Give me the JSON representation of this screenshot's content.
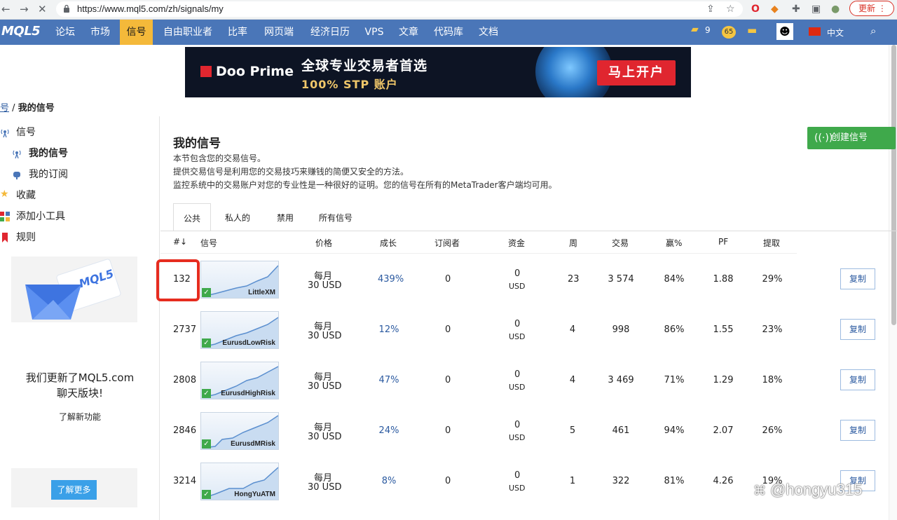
{
  "browser": {
    "url": "https://www.mql5.com/zh/signals/my",
    "update_label": "更新"
  },
  "nav": {
    "logo": "MQL5",
    "items": [
      "论坛",
      "市场",
      "信号",
      "自由职业者",
      "比率",
      "网页端",
      "经济日历",
      "VPS",
      "文章",
      "代码库",
      "文档"
    ],
    "active_index": 2,
    "folder_count": "9",
    "badge_count": "65",
    "language": "中文"
  },
  "banner": {
    "brand": "Doo Prime",
    "headline": "全球专业交易者首选",
    "subline": "100% STP 账户",
    "cta": "马上开户"
  },
  "breadcrumb": {
    "parent": "号",
    "separator": "/",
    "current": "我的信号"
  },
  "sidebar": {
    "items": [
      {
        "label": "信号",
        "icon": "antenna-icon"
      },
      {
        "label": "我的信号",
        "icon": "antenna-icon"
      },
      {
        "label": "我的订阅",
        "icon": "mailbox-icon"
      },
      {
        "label": "收藏",
        "icon": "star-icon"
      },
      {
        "label": "添加小工具",
        "icon": "widgets-icon"
      },
      {
        "label": "规则",
        "icon": "bookmark-icon"
      }
    ],
    "promo_card_logo": "MQL5",
    "promo_text_line1": "我们更新了MQL5.com",
    "promo_text_line2": "聊天版块!",
    "promo_link": "了解新功能",
    "learn_more": "了解更多"
  },
  "main": {
    "title": "我的信号",
    "desc1": "本节包含您的交易信号。",
    "desc2": "提供交易信号是利用您的交易技巧来赚钱的简便又安全的方法。",
    "desc3": "监控系统中的交易账户对您的专业性是一种很好的证明。您的信号在所有的MetaTrader客户端均可用。",
    "create_button": "创建信号",
    "tabs": [
      "公共",
      "私人的",
      "禁用",
      "所有信号"
    ],
    "active_tab": 0
  },
  "table": {
    "headers": {
      "num": "#↓",
      "signal": "信号",
      "price": "价格",
      "growth": "成长",
      "subscribers": "订阅者",
      "funds": "资金",
      "weeks": "周",
      "trades": "交易",
      "win": "赢%",
      "pf": "PF",
      "dd": "提取"
    },
    "copy_label": "复制",
    "rows": [
      {
        "num": "132",
        "name": "LittleXM",
        "price_period": "每月",
        "price": "30 USD",
        "growth": "439%",
        "subscribers": "0",
        "funds": "0",
        "funds_currency": "USD",
        "weeks": "23",
        "trades": "3 574",
        "win": "84%",
        "pf": "1.88",
        "dd": "29%"
      },
      {
        "num": "2737",
        "name": "EurusdLowRisk",
        "price_period": "每月",
        "price": "30 USD",
        "growth": "12%",
        "subscribers": "0",
        "funds": "0",
        "funds_currency": "USD",
        "weeks": "4",
        "trades": "998",
        "win": "86%",
        "pf": "1.55",
        "dd": "23%"
      },
      {
        "num": "2808",
        "name": "EurusdHighRisk",
        "price_period": "每月",
        "price": "30 USD",
        "growth": "47%",
        "subscribers": "0",
        "funds": "0",
        "funds_currency": "USD",
        "weeks": "4",
        "trades": "3 469",
        "win": "71%",
        "pf": "1.29",
        "dd": "18%"
      },
      {
        "num": "2846",
        "name": "EurusdMRisk",
        "price_period": "每月",
        "price": "30 USD",
        "growth": "24%",
        "subscribers": "0",
        "funds": "0",
        "funds_currency": "USD",
        "weeks": "5",
        "trades": "461",
        "win": "94%",
        "pf": "2.07",
        "dd": "26%"
      },
      {
        "num": "3214",
        "name": "HongYuATM",
        "price_period": "每月",
        "price": "30 USD",
        "growth": "8%",
        "subscribers": "0",
        "funds": "0",
        "funds_currency": "USD",
        "weeks": "1",
        "trades": "322",
        "win": "81%",
        "pf": "4.26",
        "dd": "19%"
      }
    ]
  },
  "watermark": "@hongyu315",
  "colors": {
    "nav_bg": "#4a76b8",
    "nav_active": "#f4b93a",
    "create_btn": "#3fa94b",
    "highlight": "#e62c1f",
    "link": "#2b5aa0"
  }
}
